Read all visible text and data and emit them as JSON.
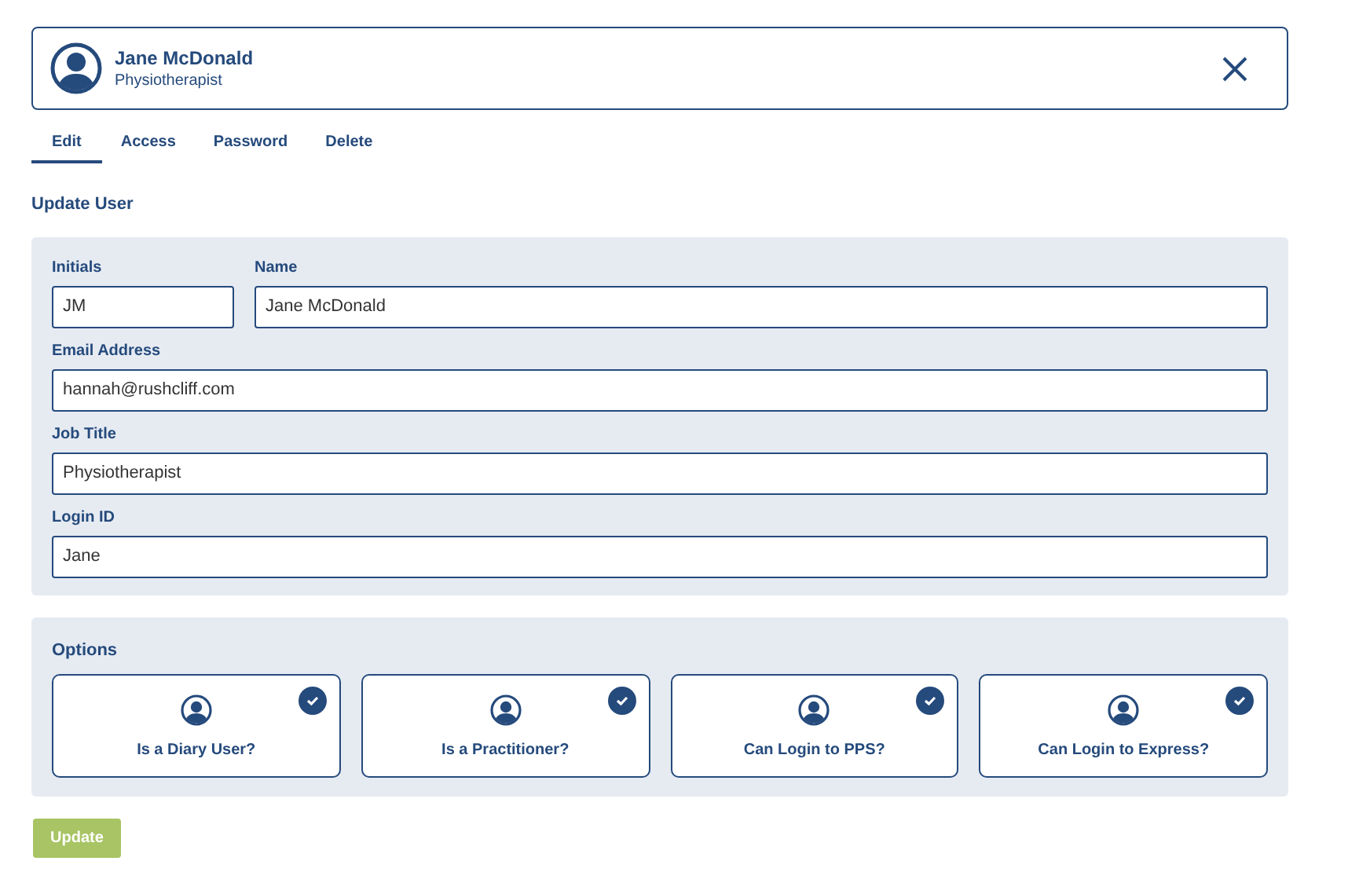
{
  "user": {
    "name": "Jane McDonald",
    "role": "Physiotherapist"
  },
  "tabs": [
    {
      "label": "Edit",
      "selected": true
    },
    {
      "label": "Access",
      "selected": false
    },
    {
      "label": "Password",
      "selected": false
    },
    {
      "label": "Delete",
      "selected": false
    }
  ],
  "heading": "Update User",
  "fields": [
    {
      "label": "Initials",
      "value": "JM"
    },
    {
      "label": "Name",
      "value": "Jane McDonald"
    },
    {
      "label": "Email Address",
      "value": "hannah@rushcliff.com"
    },
    {
      "label": "Job Title",
      "value": "Physiotherapist"
    },
    {
      "label": "Login ID",
      "value": "Jane"
    }
  ],
  "options": {
    "title": "Options",
    "items": [
      {
        "label": "Is a Diary User?",
        "checked": true
      },
      {
        "label": "Is a Practitioner?",
        "checked": true
      },
      {
        "label": "Can Login to PPS?",
        "checked": true
      },
      {
        "label": "Can Login to Express?",
        "checked": true
      }
    ]
  },
  "submit": "Update"
}
